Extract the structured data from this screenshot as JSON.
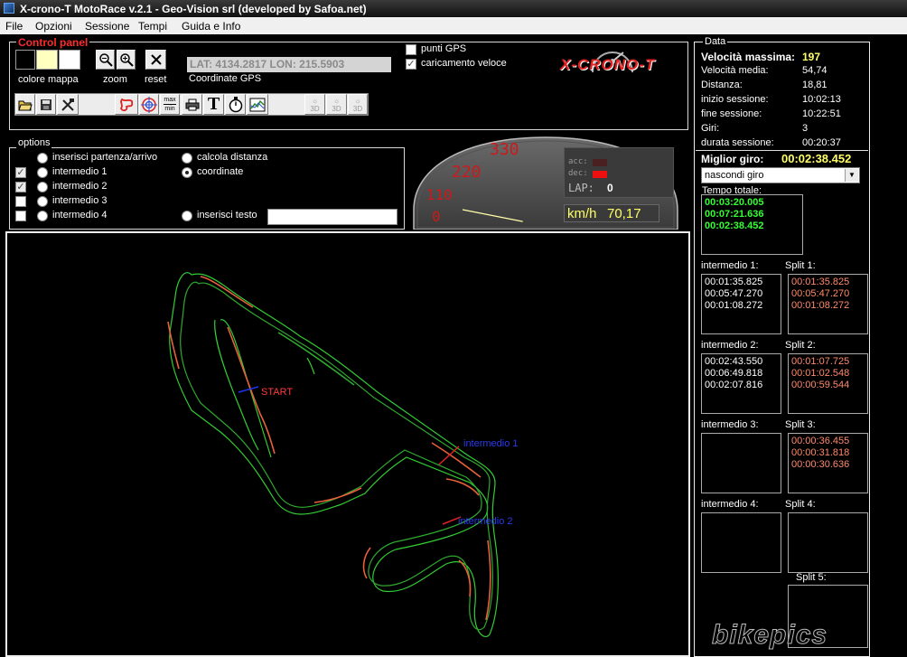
{
  "window": {
    "title": "X-crono-T MotoRace v.2.1 - Geo-Vision srl (developed by Safoa.net)"
  },
  "menu": [
    "File",
    "Opzioni",
    "Sessione",
    "Tempi",
    "Guida e Info"
  ],
  "control_panel": {
    "title": "Control panel",
    "colore_mappa_label": "colore mappa",
    "zoom_label": "zoom",
    "reset_label": "reset",
    "coords_value": "LAT: 4134.2817 LON: 215.5903",
    "coords_label": "Coordinate GPS",
    "swatch_colors": [
      "#000000",
      "#ffffc0",
      "#ffffff"
    ],
    "toolbar_icons": [
      "open-folder-icon",
      "save-icon",
      "tools-icon",
      "blank",
      "track-icon",
      "target-icon",
      "max-min-icon",
      "print-icon",
      "text-icon",
      "stopwatch-icon",
      "chart-icon",
      "view-3d-icon",
      "view-3d-icon",
      "view-3d-icon"
    ],
    "maxmin_top": "max",
    "maxmin_bottom": "min",
    "text_glyph": "T",
    "view_3d_label": "3D",
    "punti_gps": {
      "label": "punti GPS",
      "checked": false
    },
    "caricamento_veloce": {
      "label": "caricamento veloce",
      "checked": true
    },
    "logo_text": "X-CRONO-T"
  },
  "options": {
    "title": "options",
    "left_rows": [
      {
        "label": "inserisci partenza/arrivo",
        "check": "none",
        "radio": false
      },
      {
        "label": "intermedio 1",
        "check": "checked",
        "radio": false
      },
      {
        "label": "intermedio 2",
        "check": "checked",
        "radio": false
      },
      {
        "label": "intermedio 3",
        "check": "unchecked",
        "radio": false
      },
      {
        "label": "intermedio 4",
        "check": "unchecked",
        "radio": false
      }
    ],
    "calcola_distanza": {
      "label": "calcola distanza",
      "selected": false
    },
    "coordinate": {
      "label": "coordinate",
      "selected": true
    },
    "inserisci_testo": {
      "label": "inserisci testo",
      "selected": false,
      "value": ""
    }
  },
  "gauge": {
    "scale": [
      "330",
      "220",
      "110",
      "0"
    ],
    "acc_label": "acc:",
    "dec_label": "dec:",
    "lap_label": "LAP:",
    "lap_value": "0",
    "speed_unit": "km/h",
    "speed_value": "70,17",
    "needle_fraction": 0.2126,
    "accent_color": "#cc1a1a"
  },
  "map": {
    "start_label": "START",
    "split_labels": [
      "intermedio 1",
      "intermedio 2"
    ],
    "track_colors": [
      "#33cc33",
      "#e8603c"
    ]
  },
  "data_panel": {
    "title": "Data",
    "stats": [
      {
        "label": "Velocità massima:",
        "value": "197",
        "highlight": true
      },
      {
        "label": "Velocità media:",
        "value": "54,74"
      },
      {
        "label": "Distanza:",
        "value": "18,81"
      },
      {
        "label": "inizio sessione:",
        "value": "10:02:13"
      },
      {
        "label": "fine sessione:",
        "value": "10:22:51"
      },
      {
        "label": "Giri:",
        "value": "3"
      },
      {
        "label": "durata sessione:",
        "value": "00:20:37"
      }
    ],
    "best_lap_label": "Miglior giro:",
    "best_lap_value": "00:02:38.452",
    "lap_select": "nascondi giro",
    "tempo_totale_label": "Tempo totale:",
    "tempo_totale": [
      "00:03:20.005",
      "00:07:21.636",
      "00:02:38.452"
    ],
    "intermedio_labels": [
      "intermedio 1:",
      "intermedio 2:",
      "intermedio 3:",
      "intermedio 4:"
    ],
    "split_labels": [
      "Split 1:",
      "Split 2:",
      "Split 3:",
      "Split 4:",
      "Split 5:"
    ],
    "intermedio_1": [
      "00:01:35.825",
      "00:05:47.270",
      "00:01:08.272"
    ],
    "intermedio_2": [
      "00:02:43.550",
      "00:06:49.818",
      "00:02:07.816"
    ],
    "split_1": [
      "00:01:35.825",
      "00:05:47.270",
      "00:01:08.272"
    ],
    "split_2": [
      "00:01:07.725",
      "00:01:02.548",
      "00:00:59.544"
    ],
    "split_3": [
      "00:00:36.455",
      "00:00:31.818",
      "00:00:30.636"
    ],
    "colors": {
      "best": "#ffff66",
      "total": "#33ff33",
      "split": "#ff8a6a"
    }
  },
  "watermark": "bikepics"
}
